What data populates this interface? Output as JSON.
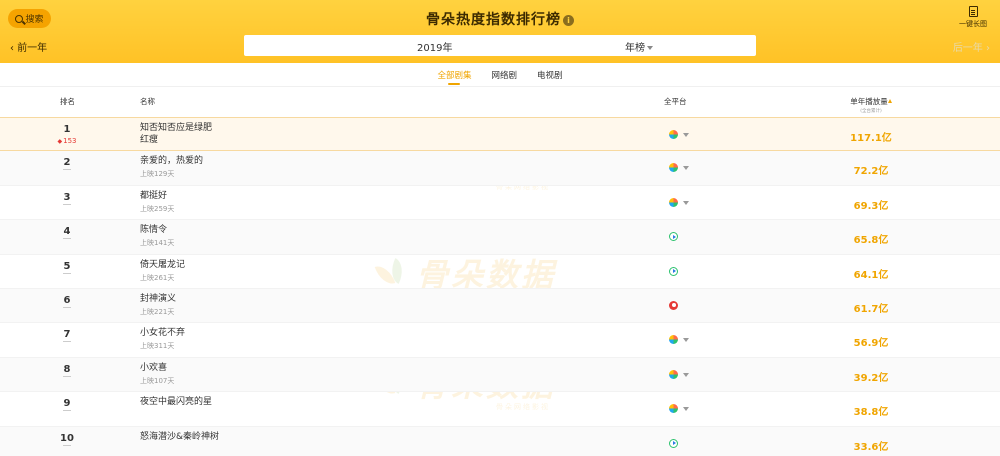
{
  "header": {
    "search_label": "搜索",
    "title": "骨朵热度指数排行榜",
    "longshot_label": "一键长图",
    "prev_label": "前一年",
    "next_label": "后一年",
    "year_value": "2019年",
    "period_value": "年榜"
  },
  "tabs": [
    {
      "label": "全部剧集",
      "active": true
    },
    {
      "label": "网络剧",
      "active": false
    },
    {
      "label": "电视剧",
      "active": false
    }
  ],
  "table_header": {
    "rank": "排名",
    "name": "名称",
    "platform": "全平台",
    "plays": "单年播放量",
    "plays_unit": "(全台累计)"
  },
  "rows": [
    {
      "rank": "1",
      "change": "153",
      "title": "知否知否应是绿肥红瘦",
      "sub": "",
      "platform": "iqiyi-icon",
      "has_caret": true,
      "plays": "117.1亿"
    },
    {
      "rank": "2",
      "change": "",
      "title": "亲爱的，热爱的",
      "sub": "上映129天",
      "platform": "iqiyi-icon",
      "has_caret": true,
      "plays": "72.2亿"
    },
    {
      "rank": "3",
      "change": "",
      "title": "都挺好",
      "sub": "上映259天",
      "platform": "iqiyi-icon",
      "has_caret": true,
      "plays": "69.3亿"
    },
    {
      "rank": "4",
      "change": "",
      "title": "陈情令",
      "sub": "上映141天",
      "platform": "tencent-video-icon",
      "has_caret": false,
      "plays": "65.8亿"
    },
    {
      "rank": "5",
      "change": "",
      "title": "倚天屠龙记",
      "sub": "上映261天",
      "platform": "tencent-video-icon",
      "has_caret": false,
      "plays": "64.1亿"
    },
    {
      "rank": "6",
      "change": "",
      "title": "封神演义",
      "sub": "上映221天",
      "platform": "youku-icon",
      "has_caret": false,
      "plays": "61.7亿"
    },
    {
      "rank": "7",
      "change": "",
      "title": "小女花不弃",
      "sub": "上映311天",
      "platform": "iqiyi-icon",
      "has_caret": true,
      "plays": "56.9亿"
    },
    {
      "rank": "8",
      "change": "",
      "title": "小欢喜",
      "sub": "上映107天",
      "platform": "iqiyi-icon",
      "has_caret": true,
      "plays": "39.2亿"
    },
    {
      "rank": "9",
      "change": "",
      "title": "夜空中最闪亮的星",
      "sub": "",
      "platform": "iqiyi-icon",
      "has_caret": true,
      "plays": "38.8亿"
    },
    {
      "rank": "10",
      "change": "",
      "title": "怒海潜沙&秦岭神树",
      "sub": "",
      "platform": "tencent-video-icon",
      "has_caret": false,
      "plays": "33.6亿"
    }
  ],
  "watermark": {
    "text": "骨朵数据",
    "sub": "骨朵网络影视"
  }
}
